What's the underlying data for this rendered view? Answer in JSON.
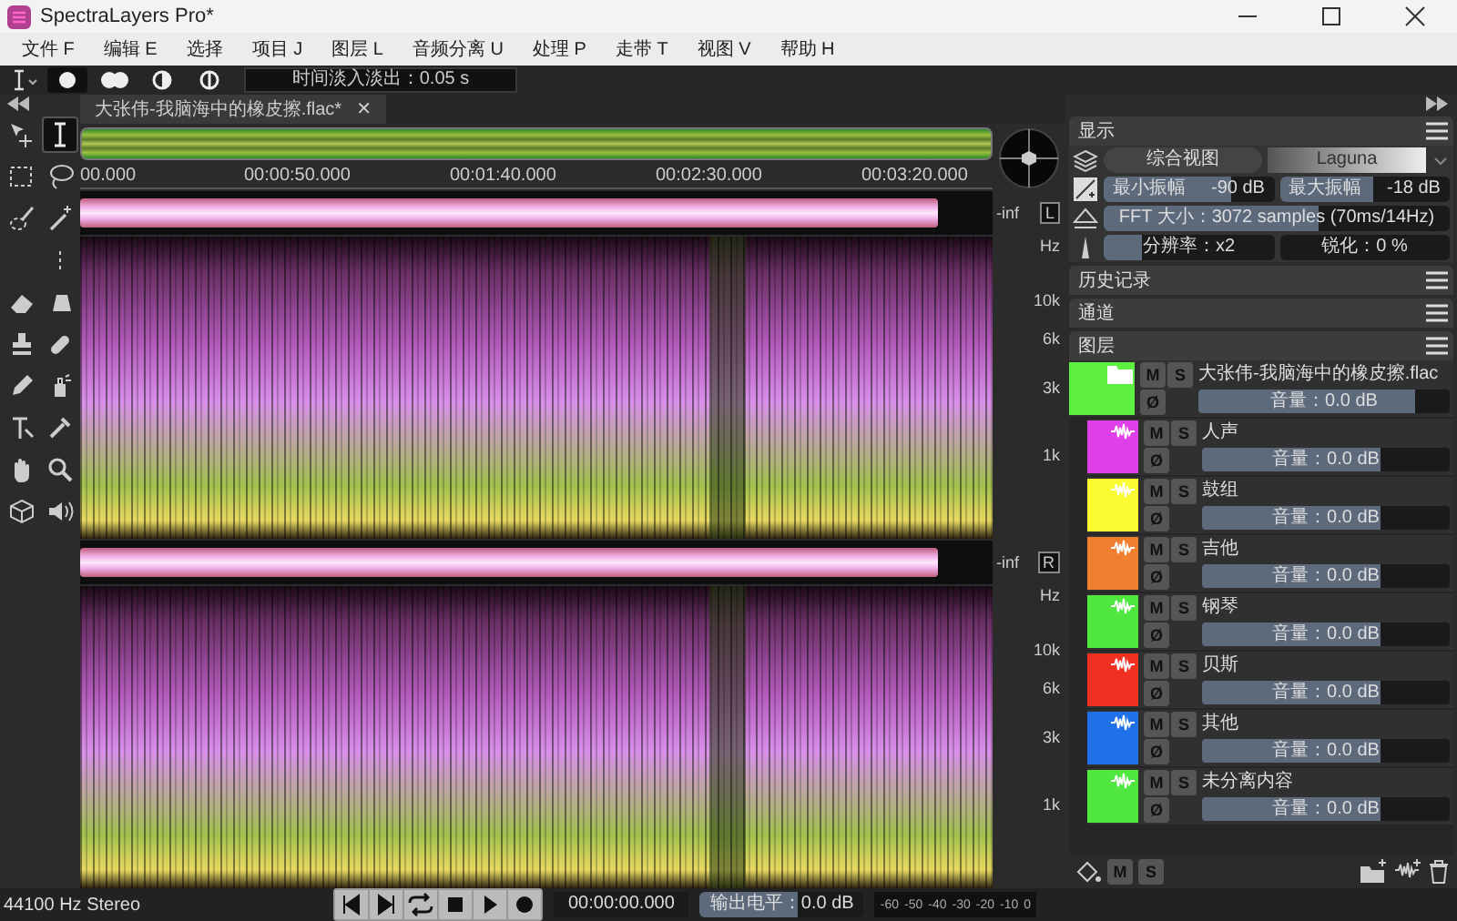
{
  "window": {
    "title": "SpectraLayers Pro*"
  },
  "menu": [
    "文件 F",
    "编辑 E",
    "选择",
    "项目 J",
    "图层 L",
    "音频分离 U",
    "处理 P",
    "走带 T",
    "视图 V",
    "帮助 H"
  ],
  "toolbar": {
    "fade_modes": [
      {
        "selected": true
      },
      {
        "selected": false
      },
      {
        "selected": false
      },
      {
        "selected": false
      }
    ],
    "fade_field": "时间淡入淡出：0.05 s"
  },
  "tools": [
    {
      "selected": false
    },
    {
      "selected": true
    },
    {
      "selected": false
    },
    {
      "selected": false
    },
    {
      "selected": false
    },
    {
      "selected": false
    },
    {
      "selected": false
    },
    {
      "selected": false
    },
    {
      "selected": false
    },
    {
      "selected": false
    },
    {
      "selected": false
    },
    {
      "selected": false
    },
    {
      "selected": false
    },
    {
      "selected": false
    },
    {
      "selected": false
    },
    {
      "selected": false
    },
    {
      "selected": false
    },
    {
      "selected": false
    },
    {
      "selected": false
    }
  ],
  "editor": {
    "tab": {
      "label": "大张伟-我脑海中的橡皮擦.flac*",
      "close": "✕"
    },
    "ruler": [
      "00.000",
      "00:00:50.000",
      "00:01:40.000",
      "00:02:30.000",
      "00:03:20.000"
    ],
    "channels": [
      {
        "peak": "-inf",
        "label": "L",
        "unit": "Hz",
        "freqs": [
          "10k",
          "6k",
          "3k",
          "1k"
        ]
      },
      {
        "peak": "-inf",
        "label": "R",
        "unit": "Hz",
        "freqs": [
          "10k",
          "6k",
          "3k",
          "1k"
        ]
      }
    ]
  },
  "display": {
    "title": "显示",
    "view_button": "综合视图",
    "colormap": "Laguna",
    "min_amp": {
      "label": "最小振幅",
      "value": "-90 dB",
      "level": 0.75
    },
    "max_amp": {
      "label": "最大振幅",
      "value": "-18 dB",
      "level": 0.55
    },
    "fft": {
      "label": "FFT 大小：3072 samples (70ms/14Hz)",
      "level": 0.62
    },
    "resolution": {
      "label": "分辨率：x2",
      "level": 0.22
    },
    "sharpness": {
      "label": "锐化：0 %",
      "level": 0
    }
  },
  "panels": [
    "历史记录",
    "通道",
    "图层"
  ],
  "layers": {
    "name": "大张伟-我脑海中的橡皮擦.flac",
    "color": "#5ef040",
    "mute": "M",
    "solo": "S",
    "phase": "Ø",
    "volume": {
      "text": "音量：0.0 dB",
      "level": 0.86
    },
    "children": [
      {
        "name": "人声",
        "color": "#e040e8",
        "mute": "M",
        "solo": "S",
        "phase": "Ø",
        "volume": {
          "text": "音量：0.0 dB",
          "level": 0.72
        }
      },
      {
        "name": "鼓组",
        "color": "#fafa30",
        "mute": "M",
        "solo": "S",
        "phase": "Ø",
        "volume": {
          "text": "音量：0.0 dB",
          "level": 0.72
        }
      },
      {
        "name": "吉他",
        "color": "#f08030",
        "mute": "M",
        "solo": "S",
        "phase": "Ø",
        "volume": {
          "text": "音量：0.0 dB",
          "level": 0.72
        }
      },
      {
        "name": "钢琴",
        "color": "#50e840",
        "mute": "M",
        "solo": "S",
        "phase": "Ø",
        "volume": {
          "text": "音量：0.0 dB",
          "level": 0.72
        }
      },
      {
        "name": "贝斯",
        "color": "#f03020",
        "mute": "M",
        "solo": "S",
        "phase": "Ø",
        "volume": {
          "text": "音量：0.0 dB",
          "level": 0.72
        }
      },
      {
        "name": "其他",
        "color": "#2070e8",
        "mute": "M",
        "solo": "S",
        "phase": "Ø",
        "volume": {
          "text": "音量：0.0 dB",
          "level": 0.72
        }
      },
      {
        "name": "未分离内容",
        "color": "#50e840",
        "mute": "M",
        "solo": "S",
        "phase": "Ø",
        "volume": {
          "text": "音量：0.0 dB",
          "level": 0.72
        }
      }
    ]
  },
  "layer_toolbar": {
    "mute": "M",
    "solo": "S"
  },
  "status": {
    "format": "44100 Hz Stereo",
    "time": "00:00:00.000",
    "output": {
      "text": "输出电平：0.0 dB",
      "level": 0.6
    },
    "meter_ticks": [
      "-60",
      "-50",
      "-40",
      "-30",
      "-20",
      "-10",
      "0"
    ]
  }
}
